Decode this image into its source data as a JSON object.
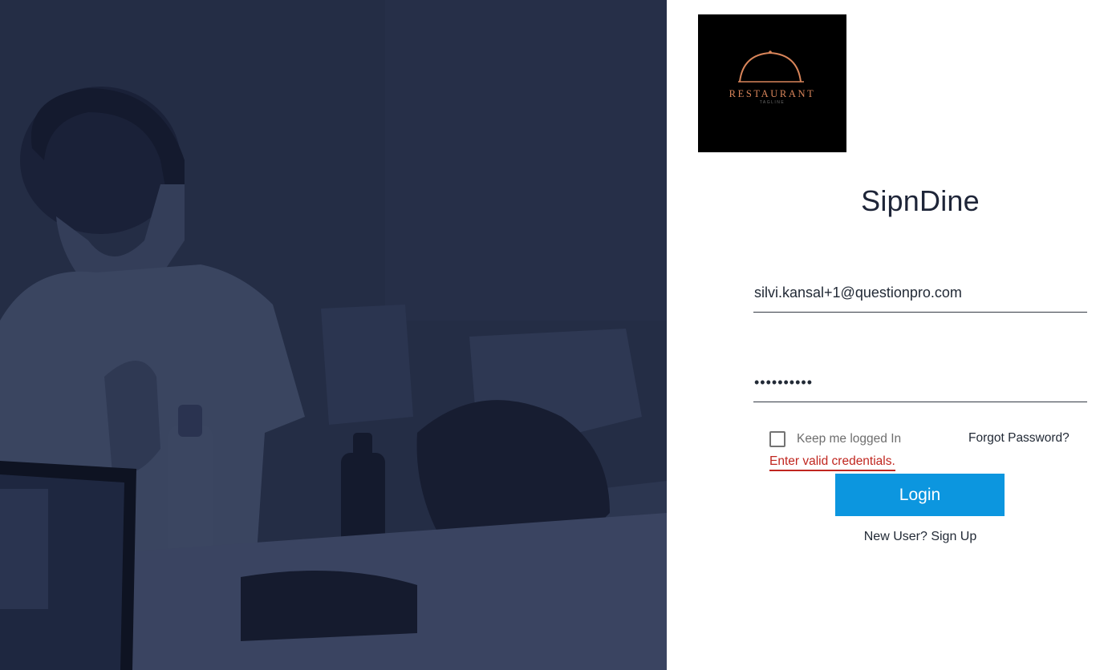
{
  "hero": {
    "icon": "background-photo"
  },
  "brand": {
    "logo_word": "RESTAURANT",
    "logo_tagline": "TAGLINE",
    "logo_accent_color": "#d9855a",
    "app_title": "SipnDine"
  },
  "form": {
    "email_value": "silvi.kansal+1@questionpro.com",
    "password_value": "••••••••••",
    "remember_label": "Keep me logged In",
    "remember_checked": false,
    "forgot_label": "Forgot Password?",
    "error_message": "Enter valid credentials.",
    "login_label": "Login",
    "new_user_text": "New User?",
    "signup_label": "Sign Up"
  },
  "colors": {
    "hero_overlay": "#232c44",
    "primary_button": "#0c96df",
    "error": "#c0261f"
  }
}
